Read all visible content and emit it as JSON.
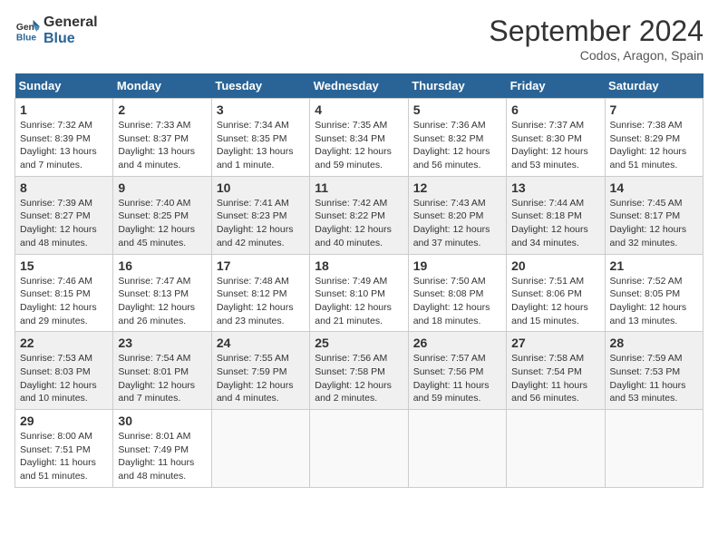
{
  "header": {
    "logo_line1": "General",
    "logo_line2": "Blue",
    "month": "September 2024",
    "location": "Codos, Aragon, Spain"
  },
  "days_of_week": [
    "Sunday",
    "Monday",
    "Tuesday",
    "Wednesday",
    "Thursday",
    "Friday",
    "Saturday"
  ],
  "weeks": [
    [
      {
        "day": "1",
        "sunrise": "Sunrise: 7:32 AM",
        "sunset": "Sunset: 8:39 PM",
        "daylight": "Daylight: 13 hours and 7 minutes."
      },
      {
        "day": "2",
        "sunrise": "Sunrise: 7:33 AM",
        "sunset": "Sunset: 8:37 PM",
        "daylight": "Daylight: 13 hours and 4 minutes."
      },
      {
        "day": "3",
        "sunrise": "Sunrise: 7:34 AM",
        "sunset": "Sunset: 8:35 PM",
        "daylight": "Daylight: 13 hours and 1 minute."
      },
      {
        "day": "4",
        "sunrise": "Sunrise: 7:35 AM",
        "sunset": "Sunset: 8:34 PM",
        "daylight": "Daylight: 12 hours and 59 minutes."
      },
      {
        "day": "5",
        "sunrise": "Sunrise: 7:36 AM",
        "sunset": "Sunset: 8:32 PM",
        "daylight": "Daylight: 12 hours and 56 minutes."
      },
      {
        "day": "6",
        "sunrise": "Sunrise: 7:37 AM",
        "sunset": "Sunset: 8:30 PM",
        "daylight": "Daylight: 12 hours and 53 minutes."
      },
      {
        "day": "7",
        "sunrise": "Sunrise: 7:38 AM",
        "sunset": "Sunset: 8:29 PM",
        "daylight": "Daylight: 12 hours and 51 minutes."
      }
    ],
    [
      {
        "day": "8",
        "sunrise": "Sunrise: 7:39 AM",
        "sunset": "Sunset: 8:27 PM",
        "daylight": "Daylight: 12 hours and 48 minutes."
      },
      {
        "day": "9",
        "sunrise": "Sunrise: 7:40 AM",
        "sunset": "Sunset: 8:25 PM",
        "daylight": "Daylight: 12 hours and 45 minutes."
      },
      {
        "day": "10",
        "sunrise": "Sunrise: 7:41 AM",
        "sunset": "Sunset: 8:23 PM",
        "daylight": "Daylight: 12 hours and 42 minutes."
      },
      {
        "day": "11",
        "sunrise": "Sunrise: 7:42 AM",
        "sunset": "Sunset: 8:22 PM",
        "daylight": "Daylight: 12 hours and 40 minutes."
      },
      {
        "day": "12",
        "sunrise": "Sunrise: 7:43 AM",
        "sunset": "Sunset: 8:20 PM",
        "daylight": "Daylight: 12 hours and 37 minutes."
      },
      {
        "day": "13",
        "sunrise": "Sunrise: 7:44 AM",
        "sunset": "Sunset: 8:18 PM",
        "daylight": "Daylight: 12 hours and 34 minutes."
      },
      {
        "day": "14",
        "sunrise": "Sunrise: 7:45 AM",
        "sunset": "Sunset: 8:17 PM",
        "daylight": "Daylight: 12 hours and 32 minutes."
      }
    ],
    [
      {
        "day": "15",
        "sunrise": "Sunrise: 7:46 AM",
        "sunset": "Sunset: 8:15 PM",
        "daylight": "Daylight: 12 hours and 29 minutes."
      },
      {
        "day": "16",
        "sunrise": "Sunrise: 7:47 AM",
        "sunset": "Sunset: 8:13 PM",
        "daylight": "Daylight: 12 hours and 26 minutes."
      },
      {
        "day": "17",
        "sunrise": "Sunrise: 7:48 AM",
        "sunset": "Sunset: 8:12 PM",
        "daylight": "Daylight: 12 hours and 23 minutes."
      },
      {
        "day": "18",
        "sunrise": "Sunrise: 7:49 AM",
        "sunset": "Sunset: 8:10 PM",
        "daylight": "Daylight: 12 hours and 21 minutes."
      },
      {
        "day": "19",
        "sunrise": "Sunrise: 7:50 AM",
        "sunset": "Sunset: 8:08 PM",
        "daylight": "Daylight: 12 hours and 18 minutes."
      },
      {
        "day": "20",
        "sunrise": "Sunrise: 7:51 AM",
        "sunset": "Sunset: 8:06 PM",
        "daylight": "Daylight: 12 hours and 15 minutes."
      },
      {
        "day": "21",
        "sunrise": "Sunrise: 7:52 AM",
        "sunset": "Sunset: 8:05 PM",
        "daylight": "Daylight: 12 hours and 13 minutes."
      }
    ],
    [
      {
        "day": "22",
        "sunrise": "Sunrise: 7:53 AM",
        "sunset": "Sunset: 8:03 PM",
        "daylight": "Daylight: 12 hours and 10 minutes."
      },
      {
        "day": "23",
        "sunrise": "Sunrise: 7:54 AM",
        "sunset": "Sunset: 8:01 PM",
        "daylight": "Daylight: 12 hours and 7 minutes."
      },
      {
        "day": "24",
        "sunrise": "Sunrise: 7:55 AM",
        "sunset": "Sunset: 7:59 PM",
        "daylight": "Daylight: 12 hours and 4 minutes."
      },
      {
        "day": "25",
        "sunrise": "Sunrise: 7:56 AM",
        "sunset": "Sunset: 7:58 PM",
        "daylight": "Daylight: 12 hours and 2 minutes."
      },
      {
        "day": "26",
        "sunrise": "Sunrise: 7:57 AM",
        "sunset": "Sunset: 7:56 PM",
        "daylight": "Daylight: 11 hours and 59 minutes."
      },
      {
        "day": "27",
        "sunrise": "Sunrise: 7:58 AM",
        "sunset": "Sunset: 7:54 PM",
        "daylight": "Daylight: 11 hours and 56 minutes."
      },
      {
        "day": "28",
        "sunrise": "Sunrise: 7:59 AM",
        "sunset": "Sunset: 7:53 PM",
        "daylight": "Daylight: 11 hours and 53 minutes."
      }
    ],
    [
      {
        "day": "29",
        "sunrise": "Sunrise: 8:00 AM",
        "sunset": "Sunset: 7:51 PM",
        "daylight": "Daylight: 11 hours and 51 minutes."
      },
      {
        "day": "30",
        "sunrise": "Sunrise: 8:01 AM",
        "sunset": "Sunset: 7:49 PM",
        "daylight": "Daylight: 11 hours and 48 minutes."
      },
      null,
      null,
      null,
      null,
      null
    ]
  ]
}
